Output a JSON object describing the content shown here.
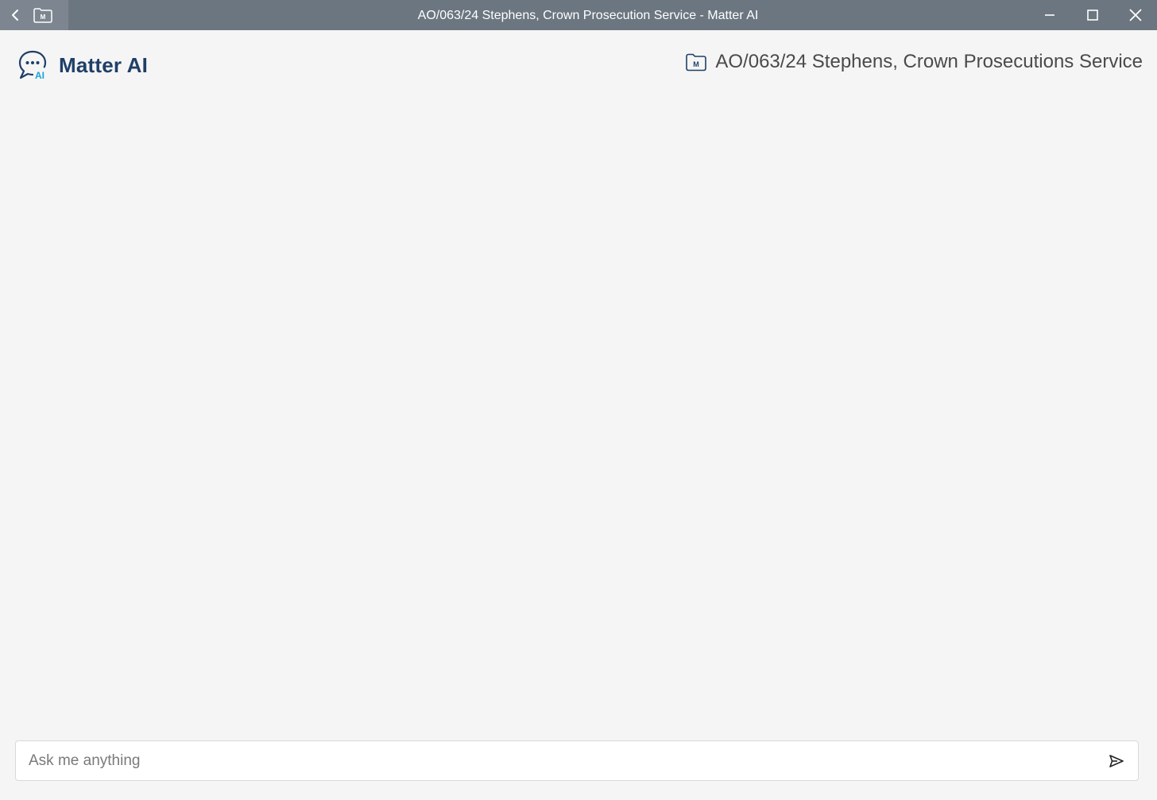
{
  "window": {
    "title": "AO/063/24 Stephens, Crown Prosecution Service - Matter AI"
  },
  "titlebar": {
    "back_icon": "chevron-left-icon",
    "folder_icon": "matter-folder-icon",
    "folder_letter": "M",
    "controls": [
      "minimize",
      "maximize",
      "close"
    ]
  },
  "brand": {
    "name": "Matter AI",
    "logo_badge": "AI",
    "logo_icon": "chat-bubble-ai-icon"
  },
  "matter": {
    "name": "AO/063/24 Stephens, Crown Prosecutions Service",
    "icon": "matter-folder-icon",
    "folder_letter": "M"
  },
  "chat_input": {
    "placeholder": "Ask me anything",
    "value": "",
    "send_icon": "send-icon"
  },
  "colors": {
    "titlebar_bg": "#6c7681",
    "brand_navy": "#1f3f67",
    "brand_accent": "#1aa3dc",
    "app_bg": "#f5f5f5"
  }
}
